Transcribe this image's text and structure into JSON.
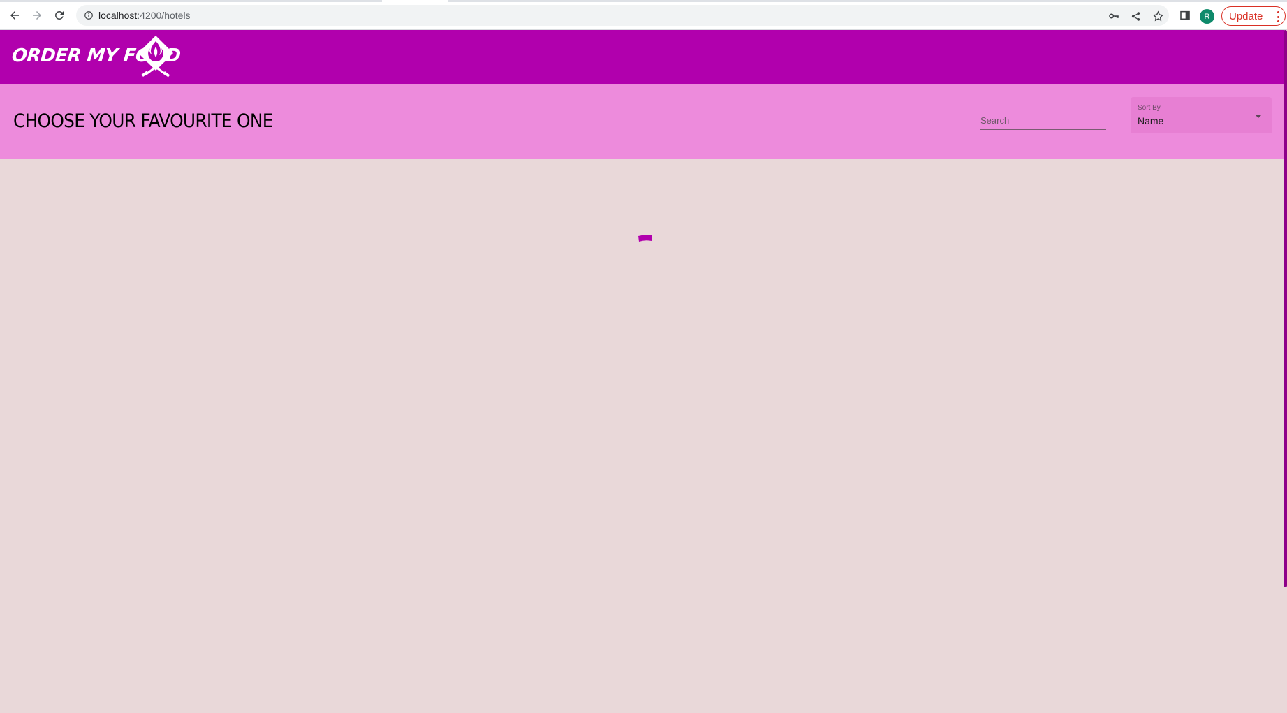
{
  "browser": {
    "url_host": "localhost",
    "url_path": ":4200/hotels",
    "profile_initial": "R",
    "update_label": "Update"
  },
  "app": {
    "brand": "ORDER MY FOOD",
    "logo_icon": "chef-flame-knives-icon",
    "header_color": "#b100ad",
    "subheader_color": "#ed8bdc",
    "background_color": "#e9d8d9"
  },
  "toolbar": {
    "title": "CHOOSE YOUR FAVOURITE ONE",
    "search_placeholder": "Search",
    "search_value": "",
    "sort_label": "Sort By",
    "sort_value": "Name"
  },
  "main": {
    "loading": true,
    "spinner_color": "#b100ad"
  }
}
